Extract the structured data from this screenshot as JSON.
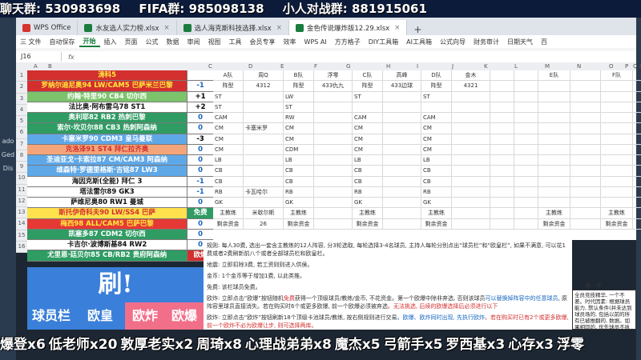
{
  "top_banner": {
    "segments": [
      "聊天群: 530983698",
      "FIFA群: 985098138",
      "小人对战群: 881915061"
    ]
  },
  "tabs": [
    {
      "label": "WPS Office",
      "color": "#d6322e",
      "active": false
    },
    {
      "label": "水友选人实力榜.xlsx",
      "color": "#1a7d3e",
      "active": false
    },
    {
      "label": "选人海克斯科技选择.xlsx",
      "color": "#1a7d3e",
      "active": false
    },
    {
      "label": "金色传说爆炸版12.29.xlsx",
      "color": "#1a7d3e",
      "active": true
    }
  ],
  "tab_plus": "+",
  "menu": {
    "items": [
      "三 文件",
      "自动保存",
      "开始",
      "插入",
      "页面",
      "公式",
      "数据",
      "审阅",
      "视图",
      "工具",
      "会员专享",
      "效率",
      "WPS AI",
      "方方格子",
      "DIY工具箱",
      "AI工具箱",
      "公式向导",
      "财务审计",
      "日期天气",
      "百"
    ],
    "active_index": 2
  },
  "formula_bar": {
    "cell_ref": "J16",
    "fx": "fx"
  },
  "columns": [
    "A",
    "B",
    "C",
    "D",
    "E",
    "F",
    "G",
    "H",
    "I",
    "J",
    "K",
    "L",
    "M",
    "N",
    "O",
    "P",
    "Q",
    "R",
    "S",
    "T"
  ],
  "row_numbers": [
    "1",
    "2",
    "3",
    "4",
    "5",
    "6",
    "7",
    "8",
    "9",
    "10",
    "11",
    "12",
    "13",
    "14",
    "15",
    "16"
  ],
  "player_list": [
    {
      "name": "涛科5",
      "score": "",
      "bg": "#d32f2f",
      "fg": "#ffeb3b",
      "score_fg": "#000000"
    },
    {
      "name": "罗纳尔迪尼奥94 LW/CAM5 巴萨米兰巴黎",
      "score": "-1",
      "bg": "#d32f2f",
      "fg": "#ffeb3b",
      "score_fg": "#1565c0"
    },
    {
      "name": "约翰·特里90 CB4 切尔西",
      "score": "+1",
      "bg": "#7cc36c",
      "fg": "#ffffff",
      "score_fg": "#000000"
    },
    {
      "name": "法比奥·阿布雷乌78 ST1",
      "score": "+2",
      "bg": "#ffffff",
      "fg": "#111111",
      "score_fg": "#000000"
    },
    {
      "name": "奥利耶82 RB2 热刺巴黎",
      "score": "0",
      "bg": "#2e9c63",
      "fg": "#ffffff",
      "score_fg": "#1565c0"
    },
    {
      "name": "索尔·坎贝尔88 CB3 热刺阿森纳",
      "score": "0",
      "bg": "#2e9c63",
      "fg": "#ffffff",
      "score_fg": "#1565c0"
    },
    {
      "name": "卡塞米罗90 CDM3 皇马曼联",
      "score": "-3",
      "bg": "#5fa8e8",
      "fg": "#ffffff",
      "score_fg": "#000000"
    },
    {
      "name": "克洛泽91 ST4 拜仁拉齐奥",
      "score": "0",
      "bg": "#f4a67a",
      "fg": "#d32f2f",
      "score_fg": "#1565c0"
    },
    {
      "name": "圣迪亚戈·卡索拉87 CM/CAM3 阿森纳",
      "score": "0",
      "bg": "#5fa8e8",
      "fg": "#ffffff",
      "score_fg": "#1565c0"
    },
    {
      "name": "维森特·罗德里格斯·吉铭87 LW3",
      "score": "0",
      "bg": "#5fa8e8",
      "fg": "#ffffff",
      "score_fg": "#1565c0"
    },
    {
      "name": "海因克斯(全能) 拜仁 3",
      "score": "-1",
      "bg": "#ffffff",
      "fg": "#111111",
      "score_fg": "#1565c0"
    },
    {
      "name": "塔法雷尔89 GK3",
      "score": "-1",
      "bg": "#ffffff",
      "fg": "#111111",
      "score_fg": "#1565c0"
    },
    {
      "name": "萨维尼奥80 RW1 曼城",
      "score": "0",
      "bg": "#ffffff",
      "fg": "#111111",
      "score_fg": "#1565c0"
    },
    {
      "name": "斯托伊奇科夫90 LW/SS4 巴萨",
      "score": "免费",
      "bg": "#ffe14d",
      "fg": "#d32f2f",
      "score_fg": "#ffffff",
      "score_bg": "#2e9c63"
    },
    {
      "name": "梅西98 ALL/CAM5 巴萨巴黎",
      "score": "0",
      "bg": "#e53935",
      "fg": "#ffeb3b",
      "score_fg": "#1565c0"
    },
    {
      "name": "凯塞多87 CDM2 切尔西",
      "score": "0",
      "bg": "#2e9c63",
      "fg": "#ffffff",
      "score_fg": "#1565c0"
    },
    {
      "name": "卡吉尔·波博斯基84 RW2",
      "score": "0",
      "bg": "#ffffff",
      "fg": "#111111",
      "score_fg": "#1565c0"
    },
    {
      "name": "尤里恩·廷贝尔85 CB/RB2 贵府阿森纳",
      "score": "欧爆",
      "bg": "#2e9c63",
      "fg": "#ffffff",
      "score_fg": "#ffffff",
      "score_bg": "#d32f2f"
    }
  ],
  "grid": {
    "header_row": [
      "A队",
      "周Q",
      "B队",
      "浮零",
      "C队",
      "高峰",
      "D队",
      "金木",
      "",
      "",
      "E队",
      "",
      "F队",
      ""
    ],
    "formation_row": [
      "阵型",
      "4312",
      "阵型",
      "433仇九",
      "阵型",
      "433边球",
      "阵型",
      "4321",
      "",
      "",
      "",
      "",
      "",
      ""
    ],
    "position_rows": [
      [
        "ST",
        "",
        "LW",
        "",
        "ST",
        "",
        "ST",
        "",
        "",
        "",
        "",
        "",
        "",
        ""
      ],
      [
        "ST",
        "",
        "ST",
        "",
        "",
        "",
        "",
        "",
        "",
        "",
        "",
        "",
        "",
        ""
      ],
      [
        "CAM",
        "",
        "RW",
        "",
        "CAM",
        "",
        "CAM",
        "",
        "",
        "",
        "",
        "",
        "",
        ""
      ],
      [
        "CM",
        "卡塞米罗",
        "CM",
        "",
        "CM",
        "",
        "CM",
        "",
        "",
        "",
        "",
        "",
        "",
        ""
      ],
      [
        "CM",
        "",
        "CM",
        "",
        "CM",
        "",
        "CM",
        "",
        "",
        "",
        "",
        "",
        "",
        ""
      ],
      [
        "CM",
        "",
        "CDM",
        "",
        "CM",
        "",
        "CM",
        "",
        "",
        "",
        "",
        "",
        "",
        ""
      ],
      [
        "LB",
        "",
        "LB",
        "",
        "LB",
        "",
        "LB",
        "",
        "",
        "",
        "",
        "",
        "",
        ""
      ],
      [
        "CB",
        "",
        "CB",
        "",
        "CB",
        "",
        "CB",
        "",
        "",
        "",
        "",
        "",
        "",
        ""
      ],
      [
        "CB",
        "",
        "CB",
        "",
        "CB",
        "",
        "CB",
        "",
        "",
        "",
        "",
        "",
        "",
        ""
      ],
      [
        "RB",
        "卡瓦哈尔",
        "RB",
        "",
        "RB",
        "",
        "RB",
        "",
        "",
        "",
        "",
        "",
        "",
        ""
      ],
      [
        "GK",
        "",
        "GK",
        "",
        "GK",
        "",
        "GK",
        "",
        "",
        "",
        "",
        "",
        "",
        ""
      ]
    ],
    "coach_row": [
      "主教练",
      "米歇尔斯",
      "主教练",
      "",
      "主教练",
      "",
      "主教练",
      "",
      "",
      "",
      "主教练",
      "",
      "主教练",
      ""
    ],
    "funds_row": [
      "剩余资金",
      "26",
      "剩余资金",
      "",
      "剩余资金",
      "",
      "剩余资金",
      "",
      "",
      "",
      "剩余资金",
      "",
      "剩余资金",
      ""
    ]
  },
  "rules": {
    "p1": "规则: 每人30费, 选出一套含主教练的12人阵容, 分3轮选取, 每轮选择3-4名球员, 主持人每轮分别点出“球员栏”和“欧皇栏”, 如果不满意, 可以花1费或者2费刷新前八个或者全部球员栏和欧皇栏。",
    "p2": "地震: 立即扣除3费, 若工资则则进入供侯。",
    "p3": "金币: 1个金币等于增加1费, 以此类推。",
    "p4": "免费: 该栏球员免费。",
    "p5_prefix": "欧炸: 立即点击“欧爆”按钮随机",
    "p5_red1": "免费",
    "p5_mid": "获得一个顶级球员/教练/金币, 不花资金。第一个欧爆中除非弃选, 否则该球员",
    "p5_blue": "可以替换掉阵容中的任意球员",
    "p5_rest": ", 原阵容里球员直接消失。若在购买时6个或更多欧爆, 前一个欧爆必须被弃选",
    "p5_red2": "。无法挑选, 后续的欧爆选择后必须进行以下",
    "p6_prefix": "欧炸: 立即点击“欧炸”按钮刷新18个顶级卡池球员/教练, 按右侧规则进行交易",
    "p6_blue": "。欧爆、欧炸同时出现, 先执行欧炸",
    "p6_red": "。若在购买时已有2个或更多欧爆, 前一个欧炸不必为欧爆让步, 则可选择两库。"
  },
  "side_note": {
    "label": "第一步",
    "text": "全员竞技精华, 一个不差。时代因素: 根据球员能力, 默认条件(并未达到球员场的, 包括以前的所有已被推翻的, 数据。如果相同的, 优先球员不执行。数据高低相关, 球员形状会被所 .."
  },
  "brush_panel": {
    "label": "刷!"
  },
  "option_row": [
    {
      "label": "球员栏",
      "bg": "#3a7fd9"
    },
    {
      "label": "欧皇",
      "bg": "#3a7fd9"
    },
    {
      "label": "欧炸",
      "bg": "#f26f8a"
    },
    {
      "label": "欧爆",
      "bg": "#f26f8a"
    }
  ],
  "danmaku": {
    "items": [
      "爆登x6",
      "低老师x20",
      "敦厚老实x2",
      "周琦x8",
      "心理战弟弟x8",
      "魔杰x5",
      "弓箭手x5",
      "罗西基x3",
      "心存x3",
      "浮零"
    ]
  },
  "left_strip": {
    "labels": [
      "ado",
      "Ged",
      "Dis"
    ]
  }
}
